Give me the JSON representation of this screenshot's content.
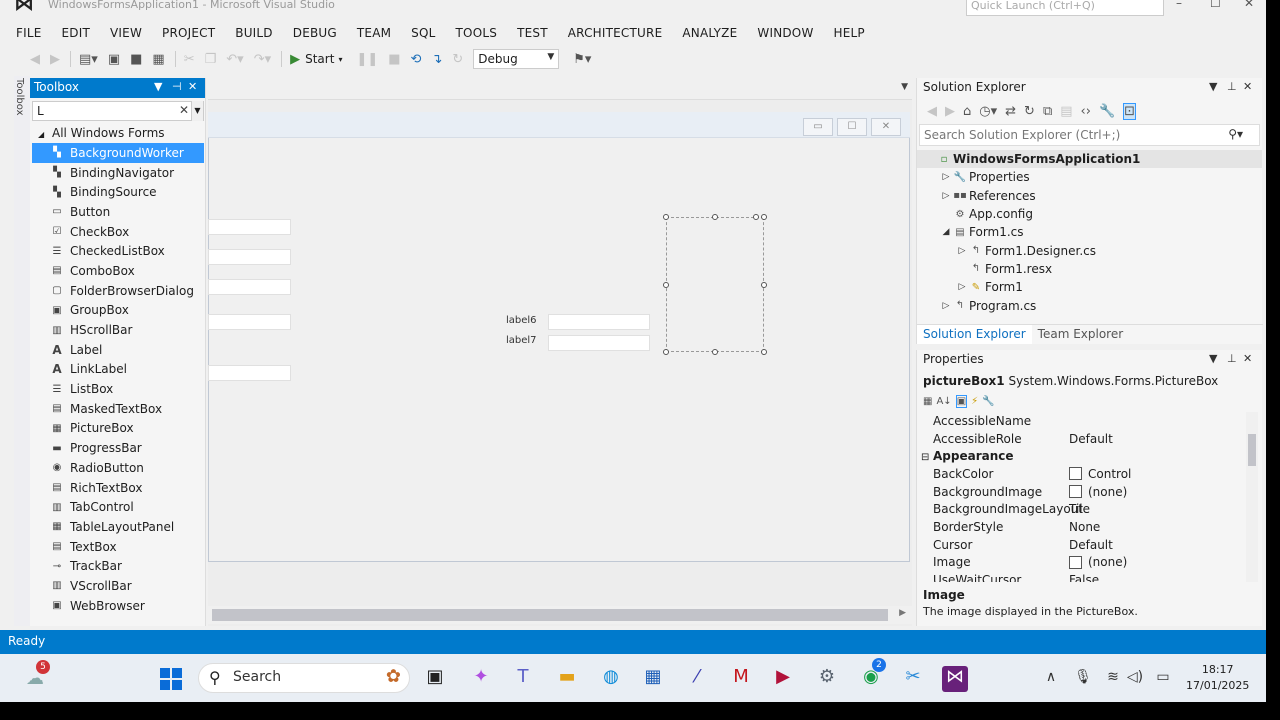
{
  "window": {
    "title": "WindowsFormsApplication1 - Microsoft Visual Studio",
    "quick_launch": "Quick Launch (Ctrl+Q)"
  },
  "menu": [
    "FILE",
    "EDIT",
    "VIEW",
    "PROJECT",
    "BUILD",
    "DEBUG",
    "TEAM",
    "SQL",
    "TOOLS",
    "TEST",
    "ARCHITECTURE",
    "ANALYZE",
    "WINDOW",
    "HELP"
  ],
  "toolbar": {
    "start_label": "Start",
    "configuration": "Debug"
  },
  "toolstrip": {
    "label": "Toolbox"
  },
  "toolbox": {
    "title": "Toolbox",
    "search_value": "L",
    "group": "All Windows Forms",
    "items": [
      {
        "label": "BackgroundWorker",
        "icon": "component-icon",
        "selected": true
      },
      {
        "label": "BindingNavigator",
        "icon": "component-icon"
      },
      {
        "label": "BindingSource",
        "icon": "component-icon"
      },
      {
        "label": "Button",
        "icon": "button-icon"
      },
      {
        "label": "CheckBox",
        "icon": "checkbox-icon"
      },
      {
        "label": "CheckedListBox",
        "icon": "list-icon"
      },
      {
        "label": "ComboBox",
        "icon": "combobox-icon"
      },
      {
        "label": "FolderBrowserDialog",
        "icon": "dialog-icon"
      },
      {
        "label": "GroupBox",
        "icon": "groupbox-icon"
      },
      {
        "label": "HScrollBar",
        "icon": "scrollbar-icon"
      },
      {
        "label": "Label",
        "icon": "label-icon"
      },
      {
        "label": "LinkLabel",
        "icon": "linklabel-icon"
      },
      {
        "label": "ListBox",
        "icon": "list-icon"
      },
      {
        "label": "MaskedTextBox",
        "icon": "textbox-icon"
      },
      {
        "label": "PictureBox",
        "icon": "picture-icon"
      },
      {
        "label": "ProgressBar",
        "icon": "progress-icon"
      },
      {
        "label": "RadioButton",
        "icon": "radio-icon"
      },
      {
        "label": "RichTextBox",
        "icon": "textbox-icon"
      },
      {
        "label": "TabControl",
        "icon": "tab-icon"
      },
      {
        "label": "TableLayoutPanel",
        "icon": "table-icon"
      },
      {
        "label": "TextBox",
        "icon": "textbox-icon"
      },
      {
        "label": "TrackBar",
        "icon": "trackbar-icon"
      },
      {
        "label": "VScrollBar",
        "icon": "scrollbar-icon"
      },
      {
        "label": "WebBrowser",
        "icon": "browser-icon"
      }
    ]
  },
  "designer": {
    "label6": "label6",
    "label7": "label7"
  },
  "solution_explorer": {
    "title": "Solution Explorer",
    "search_placeholder": "Search Solution Explorer (Ctrl+;)",
    "tree": [
      {
        "label": "WindowsFormsApplication1",
        "level": 0,
        "expander": "",
        "icon": "csharp-project-icon",
        "highlight": true
      },
      {
        "label": "Properties",
        "level": 1,
        "expander": "▷",
        "icon": "wrench-icon"
      },
      {
        "label": "References",
        "level": 1,
        "expander": "▷",
        "icon": "references-icon"
      },
      {
        "label": "App.config",
        "level": 1,
        "expander": "",
        "icon": "config-icon"
      },
      {
        "label": "Form1.cs",
        "level": 1,
        "expander": "◢",
        "icon": "form-icon"
      },
      {
        "label": "Form1.Designer.cs",
        "level": 2,
        "expander": "▷",
        "icon": "csharp-file-icon"
      },
      {
        "label": "Form1.resx",
        "level": 2,
        "expander": "",
        "icon": "resx-icon"
      },
      {
        "label": "Form1",
        "level": 2,
        "expander": "▷",
        "icon": "class-icon"
      },
      {
        "label": "Program.cs",
        "level": 1,
        "expander": "▷",
        "icon": "csharp-file-icon"
      }
    ],
    "tabs": [
      "Solution Explorer",
      "Team Explorer"
    ]
  },
  "properties": {
    "title": "Properties",
    "object_name": "pictureBox1",
    "object_type": "System.Windows.Forms.PictureBox",
    "rows": [
      {
        "name": "AccessibleName",
        "value": ""
      },
      {
        "name": "AccessibleRole",
        "value": "Default"
      },
      {
        "name": "Appearance",
        "value": "",
        "category": true
      },
      {
        "name": "BackColor",
        "value": "Control",
        "swatch": true
      },
      {
        "name": "BackgroundImage",
        "value": "(none)",
        "swatch": true
      },
      {
        "name": "BackgroundImageLayout",
        "value": "Tile"
      },
      {
        "name": "BorderStyle",
        "value": "None"
      },
      {
        "name": "Cursor",
        "value": "Default"
      },
      {
        "name": "Image",
        "value": "(none)",
        "swatch": true
      },
      {
        "name": "UseWaitCursor",
        "value": "False"
      }
    ],
    "description_title": "Image",
    "description_text": "The image displayed in the PictureBox."
  },
  "status": {
    "text": "Ready"
  },
  "taskbar": {
    "search_label": "Search",
    "weather_badge": "5",
    "chrome_badge": "2",
    "time": "18:17",
    "date": "17/01/2025"
  },
  "colors": {
    "accent": "#007acc",
    "selection": "#3399ff",
    "link": "#0e70c0"
  }
}
